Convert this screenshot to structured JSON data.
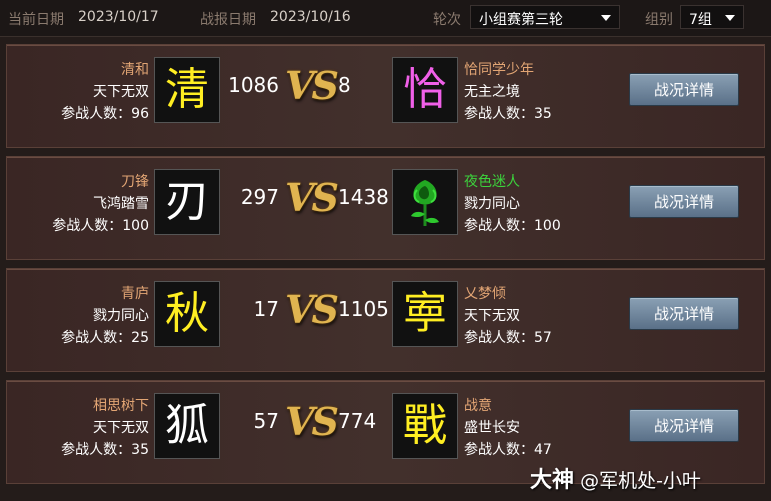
{
  "header": {
    "current_date_label": "当前日期",
    "current_date": "2023/10/17",
    "report_date_label": "战报日期",
    "report_date": "2023/10/16",
    "round_label": "轮次",
    "round_value": "小组赛第三轮",
    "group_label": "组别",
    "group_value": "7组"
  },
  "matches": [
    {
      "left": {
        "name": "清和",
        "server": "天下无双",
        "count": "参战人数：96",
        "emblem": "清",
        "emblem_color": "#ffee22"
      },
      "left_score": "1086",
      "vs": "VS",
      "right_score": "8",
      "right": {
        "name": "恰同学少年",
        "server": "无主之境",
        "count": "参战人数：35",
        "emblem": "恰",
        "emblem_color": "#f060e8"
      },
      "button": "战况详情"
    },
    {
      "left": {
        "name": "刀锋",
        "server": "飞鸿踏雪",
        "count": "参战人数：100",
        "emblem": "刃",
        "emblem_color": "#ffffff"
      },
      "left_score": "297",
      "vs": "VS",
      "right_score": "1438",
      "right": {
        "name": "夜色迷人",
        "server": "戮力同心",
        "count": "参战人数：100",
        "emblem": "",
        "emblem_icon": "green-rose-icon",
        "emblem_color": "#2ec82e"
      },
      "button": "战况详情"
    },
    {
      "left": {
        "name": "青庐",
        "server": "戮力同心",
        "count": "参战人数：25",
        "emblem": "秋",
        "emblem_color": "#ffee22"
      },
      "left_score": "17",
      "vs": "VS",
      "right_score": "1105",
      "right": {
        "name": "乂梦倾",
        "server": "天下无双",
        "count": "参战人数：57",
        "emblem": "寕",
        "emblem_color": "#ffee22"
      },
      "button": "战况详情"
    },
    {
      "left": {
        "name": "相思树下",
        "server": "天下无双",
        "count": "参战人数：35",
        "emblem": "狐",
        "emblem_color": "#ffffff"
      },
      "left_score": "57",
      "vs": "VS",
      "right_score": "774",
      "right": {
        "name": "战意",
        "server": "盛世长安",
        "count": "参战人数：47",
        "emblem": "戰",
        "emblem_color": "#ffee22"
      },
      "button": "战况详情"
    }
  ],
  "watermark": {
    "brand": "大神",
    "handle": "@军机处-小叶"
  }
}
